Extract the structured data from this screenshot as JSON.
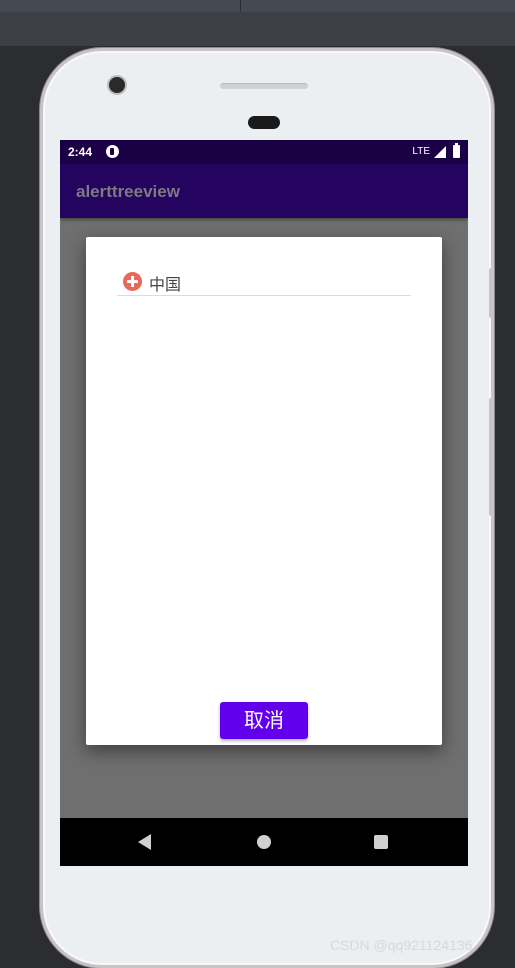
{
  "status_bar": {
    "time": "2:44",
    "network": "LTE"
  },
  "app_bar": {
    "title": "alerttreeview"
  },
  "dialog": {
    "tree_items": [
      {
        "label": "中国",
        "icon": "plus-circle-icon"
      }
    ],
    "cancel_label": "取消"
  },
  "nav_bar": {
    "icons": [
      "back-icon",
      "home-icon",
      "recents-icon"
    ]
  },
  "watermark": "CSDN @qq921124136",
  "colors": {
    "status_bar_bg": "#1a0045",
    "app_bar_bg": "#24045e",
    "cancel_button": "#6200ee",
    "expand_icon": "#e56a5c"
  }
}
